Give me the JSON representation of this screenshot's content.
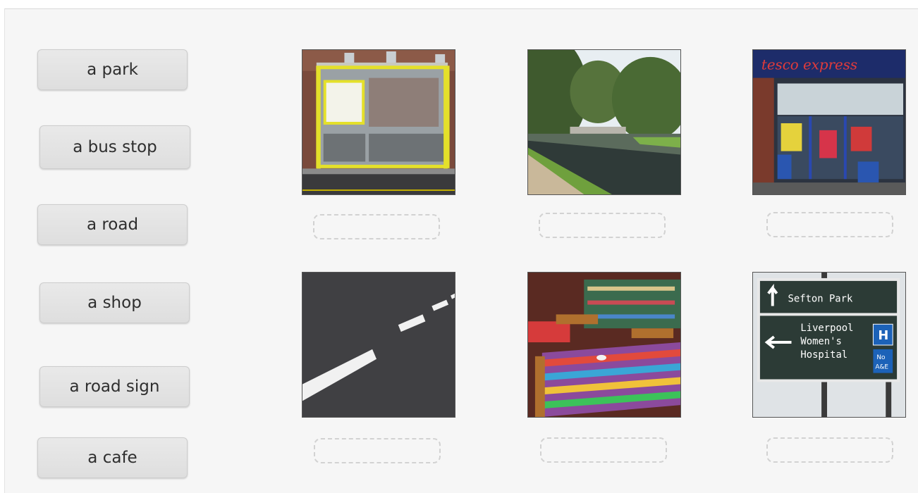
{
  "words": [
    {
      "label": "a park"
    },
    {
      "label": "a bus stop"
    },
    {
      "label": "a road"
    },
    {
      "label": "a shop"
    },
    {
      "label": "a road sign"
    },
    {
      "label": "a cafe"
    }
  ],
  "pictures": [
    {
      "subject": "bus-stop"
    },
    {
      "subject": "park-river"
    },
    {
      "subject": "shop-front",
      "signage": "tesco express"
    },
    {
      "subject": "road-markings"
    },
    {
      "subject": "cafe-tables"
    },
    {
      "subject": "road-sign",
      "sign_line1": "Sefton Park",
      "sign_line2": "Liverpool",
      "sign_line3": "Women's",
      "sign_line4": "Hospital",
      "badge_h": "H",
      "badge_no": "No",
      "badge_ae": "A&E"
    }
  ]
}
